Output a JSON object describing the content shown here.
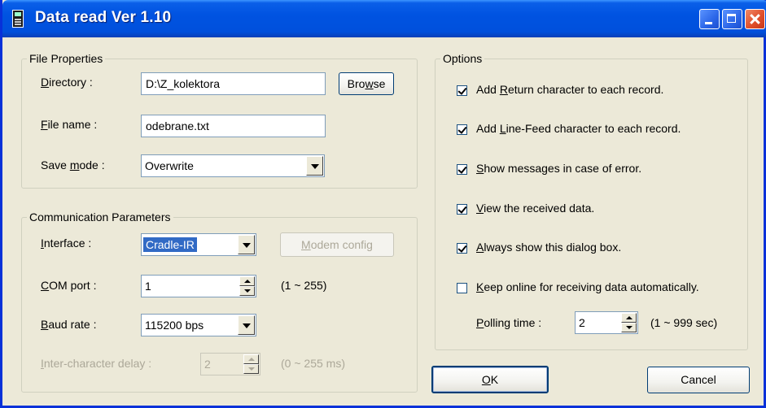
{
  "window": {
    "title": "Data read  Ver 1.10"
  },
  "file_properties": {
    "legend": "File Properties",
    "directory": {
      "label_pre": "",
      "label_u": "D",
      "label_post": "irectory :",
      "value": "D:\\Z_kolektora"
    },
    "browse_button": {
      "pre": "Bro",
      "u": "w",
      "post": "se"
    },
    "file_name": {
      "label_pre": "",
      "label_u": "F",
      "label_post": "ile name :",
      "value": "odebrane.txt"
    },
    "save_mode": {
      "label_pre": "Save ",
      "label_u": "m",
      "label_post": "ode :",
      "value": "Overwrite"
    }
  },
  "communication": {
    "legend": "Communication Parameters",
    "interface": {
      "label_pre": "",
      "label_u": "I",
      "label_post": "nterface :",
      "value": "Cradle-IR"
    },
    "modem_button": {
      "pre": "",
      "u": "M",
      "post": "odem config"
    },
    "com_port": {
      "label_pre": "",
      "label_u": "C",
      "label_post": "OM port :",
      "value": "1",
      "range": "(1 ~ 255)"
    },
    "baud_rate": {
      "label_pre": "",
      "label_u": "B",
      "label_post": "aud rate :",
      "value": "115200 bps"
    },
    "inter_char_delay": {
      "label_pre": "",
      "label_u": "I",
      "label_post": "nter-character delay :",
      "value": "2",
      "range": "(0 ~ 255 ms)"
    }
  },
  "options": {
    "legend": "Options",
    "items": [
      {
        "pre": "Add ",
        "u": "R",
        "post": "eturn character to each record.",
        "checked": true
      },
      {
        "pre": "Add ",
        "u": "L",
        "post": "ine-Feed character to each record.",
        "checked": true
      },
      {
        "pre": "",
        "u": "S",
        "post": "how messages in case of error.",
        "checked": true
      },
      {
        "pre": "",
        "u": "V",
        "post": "iew the received data.",
        "checked": true
      },
      {
        "pre": "",
        "u": "A",
        "post": "lways show this dialog box.",
        "checked": true
      },
      {
        "pre": "",
        "u": "K",
        "post": "eep online for receiving data automatically.",
        "checked": false
      }
    ],
    "polling": {
      "label_pre": "",
      "label_u": "P",
      "label_post": "olling time :",
      "value": "2",
      "range": "(1 ~ 999 sec)"
    }
  },
  "buttons": {
    "ok": {
      "pre": "",
      "u": "O",
      "post": "K"
    },
    "cancel": {
      "label": "Cancel"
    }
  }
}
